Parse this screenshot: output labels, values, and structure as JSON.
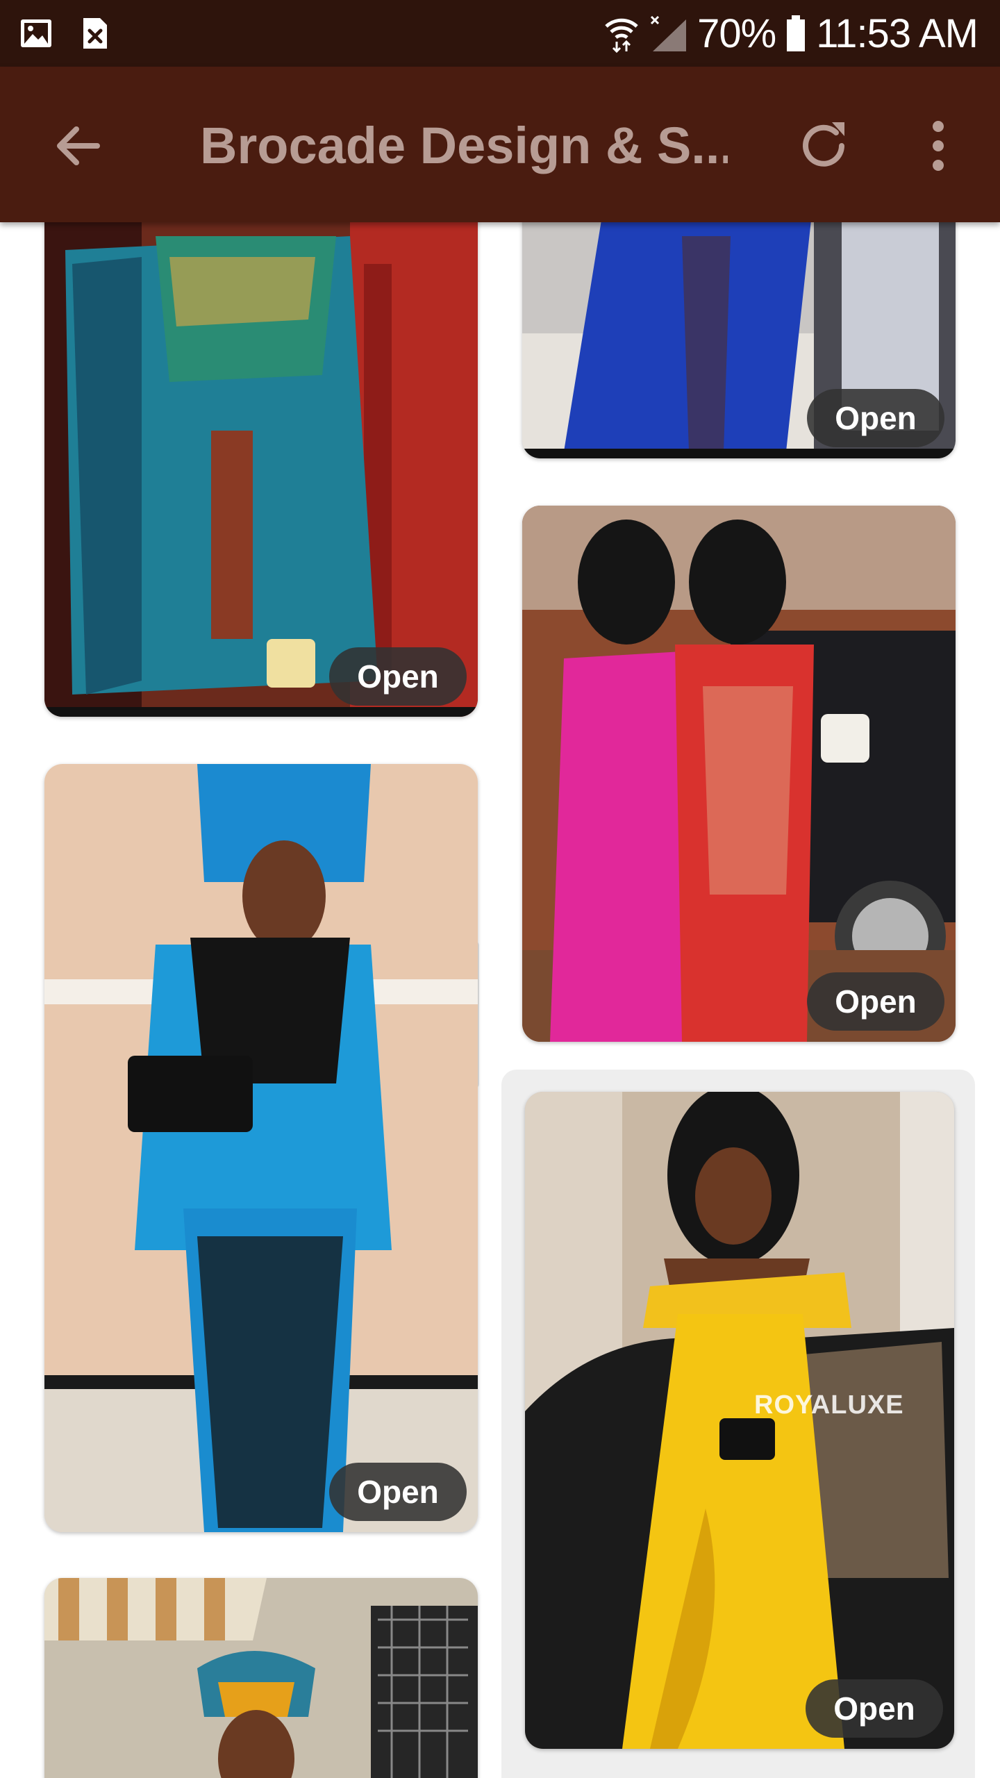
{
  "status_bar": {
    "battery": "70%",
    "time": "11:53 AM",
    "icons": [
      "image-notification-icon",
      "close-notification-icon",
      "wifi-icon",
      "signal-icon",
      "battery-icon"
    ]
  },
  "app_bar": {
    "title": "Brocade Design & S...",
    "icons": [
      "back-arrow-icon",
      "refresh-icon",
      "more-vert-icon"
    ]
  },
  "grid": {
    "open_label": "Open",
    "cards": [
      {
        "column": "left",
        "subject": "teal brocade gown with embroidered neckline"
      },
      {
        "column": "right",
        "subject": "royal blue brocade gown"
      },
      {
        "column": "right",
        "subject": "pink and red brocade gowns"
      },
      {
        "column": "left",
        "subject": "blue brocade with black lace and gele"
      },
      {
        "column": "right",
        "subject": "yellow off-shoulder brocade gown",
        "watermark": "ROYALUXE"
      },
      {
        "column": "left",
        "subject": "gown with colorful head tie"
      }
    ]
  },
  "colors": {
    "status_bar": "#2e140c",
    "app_bar": "#4a1c10",
    "title_text": "#b79c94",
    "open_button": "#323232"
  }
}
